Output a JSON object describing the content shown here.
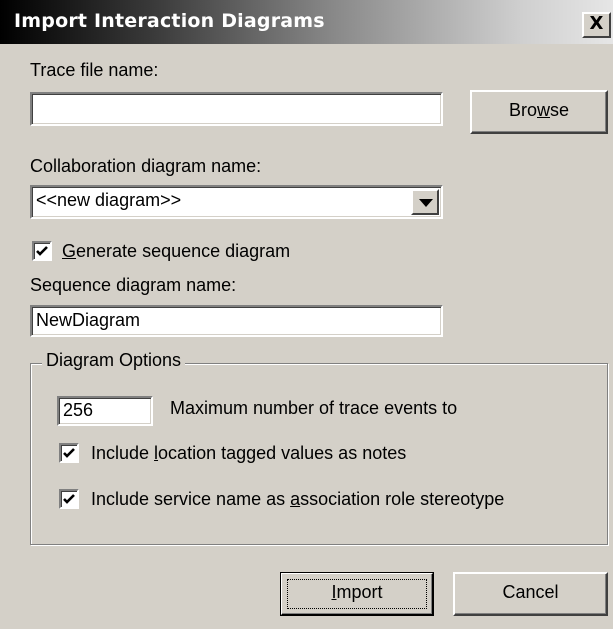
{
  "dialog": {
    "title": "Import Interaction Diagrams",
    "close_glyph": "X"
  },
  "trace": {
    "label": "Trace file name:",
    "value": "",
    "browse_pre": "Bro",
    "browse_key": "w",
    "browse_post": "se"
  },
  "collab": {
    "label": "Collaboration diagram name:",
    "selected": "<<new diagram>>"
  },
  "generate": {
    "checked": true,
    "label_key": "G",
    "label_rest": "enerate sequence diagram"
  },
  "sequence": {
    "label": "Sequence diagram name:",
    "value": "NewDiagram"
  },
  "options": {
    "group_label": "Diagram Options",
    "max_events_value": "256",
    "max_events_label": "Maximum number of trace events to",
    "location_pre": "Include ",
    "location_key": "l",
    "location_post": "ocation tagged values as notes",
    "location_checked": true,
    "service_pre": "Include service name as ",
    "service_key": "a",
    "service_post": "ssociation role stereotype",
    "service_checked": true
  },
  "buttons": {
    "import_key": "I",
    "import_rest": "mport",
    "cancel": "Cancel"
  },
  "icons": {
    "close": "close-icon",
    "dropdown": "dropdown-arrow-icon",
    "check": "checkmark-icon"
  }
}
